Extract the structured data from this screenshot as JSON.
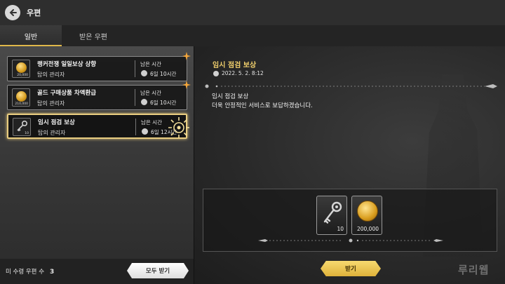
{
  "header": {
    "title": "우편"
  },
  "tabs": [
    {
      "label": "일반",
      "active": true
    },
    {
      "label": "받은 우편",
      "active": false
    }
  ],
  "mail_list": [
    {
      "title": "랭커전쟁 일일보상 상향",
      "sender": "탑의 관리자",
      "remain_label": "남은 시간",
      "remain_value": "6일 10시간",
      "thumb_qty": "20,000",
      "thumb_icon": "gold-coin-icon",
      "new": true
    },
    {
      "title": "골드 구매상품 차액환급",
      "sender": "탑의 관리자",
      "remain_label": "남은 시간",
      "remain_value": "6일 10시간",
      "thumb_qty": "210,000",
      "thumb_icon": "gold-coin-icon",
      "new": true
    },
    {
      "title": "임시 점검 보상",
      "sender": "탑의 관리자",
      "remain_label": "남은 시간",
      "remain_value": "6일 12시간",
      "thumb_qty": "10",
      "thumb_icon": "key-icon",
      "selected": true
    }
  ],
  "footer": {
    "unread_label": "미 수령 우편 수",
    "unread_count": "3",
    "receive_all_label": "모두 받기"
  },
  "detail": {
    "title": "임시 점검 보상",
    "date": "2022. 5. 2. 8:12",
    "body": "임시 점검 보상\n더욱 안정적인 서비스로 보답하겠습니다.",
    "rewards": [
      {
        "icon": "key-icon",
        "qty": "10"
      },
      {
        "icon": "gold-coin-icon",
        "qty": "200,000"
      }
    ],
    "receive_label": "받기"
  },
  "watermark": "루리웹",
  "colors": {
    "accent_gold": "#f0cf6c",
    "button_gold": "#e9c14e",
    "selected_border": "#e9cd80",
    "new_badge": "#f4a63a"
  }
}
